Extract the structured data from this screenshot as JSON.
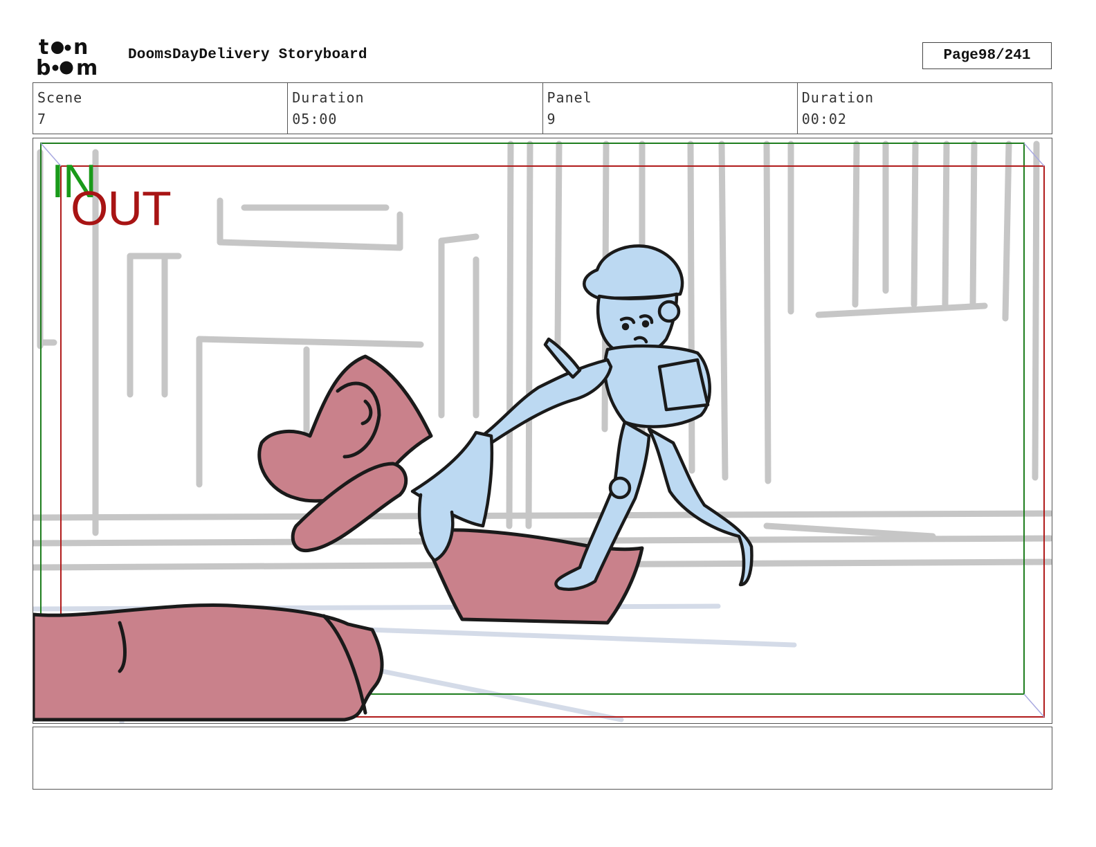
{
  "brand": {
    "logo_text": "toon boom"
  },
  "header": {
    "title": "DoomsDayDelivery Storyboard",
    "page_label": "Page",
    "page_value": "98/241"
  },
  "info": {
    "scene_label": "Scene",
    "scene_value": "7",
    "scene_duration_label": "Duration",
    "scene_duration_value": "05:00",
    "panel_label": "Panel",
    "panel_value": "9",
    "panel_duration_label": "Duration",
    "panel_duration_value": "00:02"
  },
  "panel": {
    "in_label": "IN",
    "out_label": "OUT",
    "colors": {
      "in_frame": "#1e7d1e",
      "out_frame": "#b01a1a",
      "character_fill": "#bcd9f2",
      "creature_fill": "#c9818b",
      "background_sketch": "#c4c4c4"
    }
  },
  "notes": {
    "text": ""
  }
}
